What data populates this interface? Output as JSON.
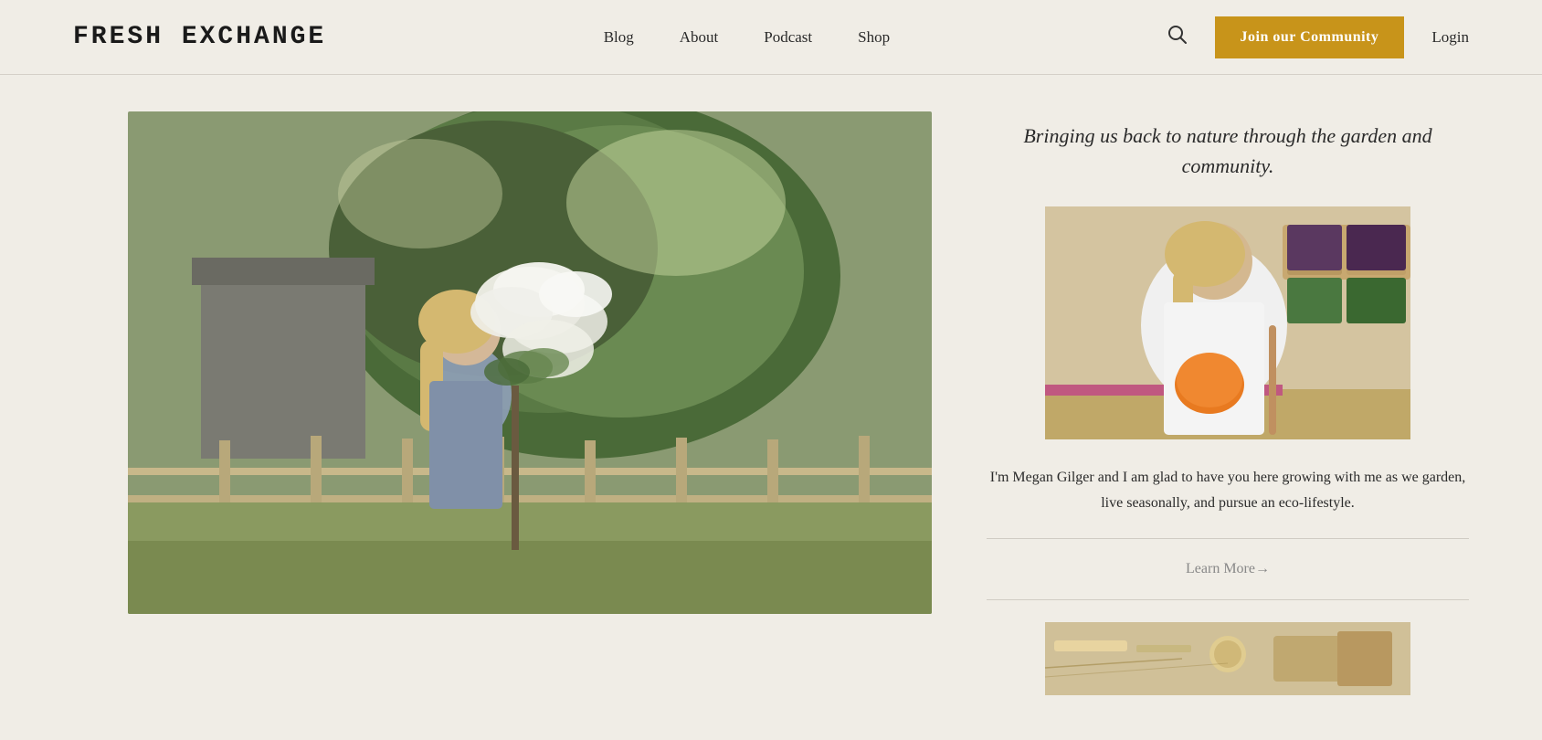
{
  "header": {
    "logo": "Fresh Exchange",
    "nav": {
      "items": [
        {
          "label": "Blog",
          "href": "#"
        },
        {
          "label": "About",
          "href": "#"
        },
        {
          "label": "Podcast",
          "href": "#"
        },
        {
          "label": "Shop",
          "href": "#"
        }
      ]
    },
    "join_button": "Join our Community",
    "login_label": "Login"
  },
  "main": {
    "sidebar": {
      "tagline": "Bringing us back to nature through the garden and community.",
      "bio": "I'm Megan Gilger and I am glad to have you here growing with me as we garden, live seasonally, and pursue an eco-lifestyle.",
      "learn_more": "Learn More→"
    }
  },
  "colors": {
    "background": "#f0ede6",
    "accent_yellow": "#c8941a",
    "text_dark": "#2a2a2a",
    "text_muted": "#888888",
    "border": "#d5d0c8"
  },
  "icons": {
    "search": "🔍"
  }
}
